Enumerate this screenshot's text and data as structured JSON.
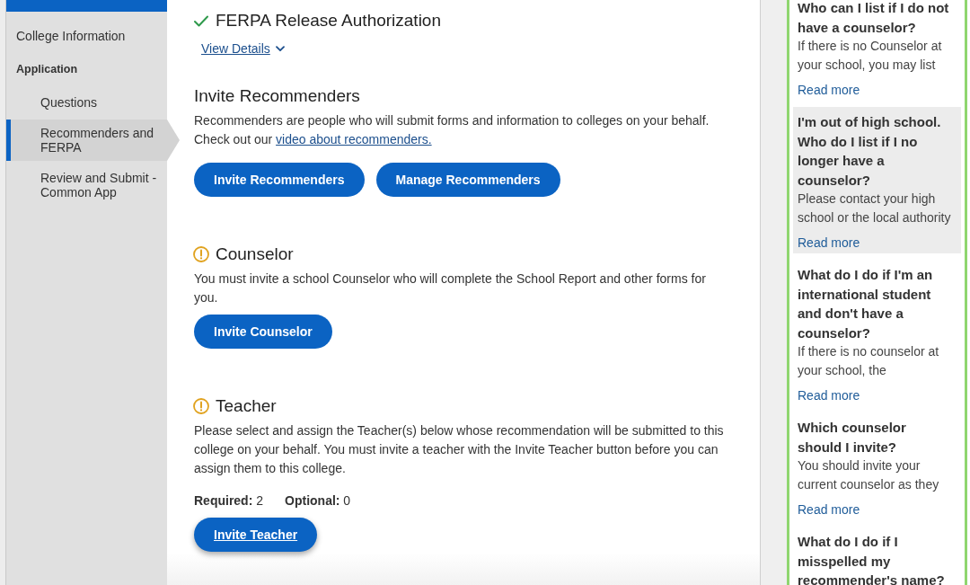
{
  "sidebar": {
    "items": [
      {
        "label": "College Information",
        "selected": false
      }
    ],
    "group": {
      "title": "Application",
      "items": [
        {
          "label": "Questions",
          "selected": false
        },
        {
          "label": "Recommenders and FERPA",
          "selected": true
        },
        {
          "label": "Review and Submit - Common App",
          "selected": false
        }
      ]
    }
  },
  "sections": [
    {
      "complete": true,
      "title": "FERPA Release Authorization",
      "link": "View Details"
    },
    {
      "title": "Invite Recommenders",
      "text": "Recommenders are people who will submit forms and information to colleges on your behalf. Check out our",
      "text_link": "video about recommenders.",
      "buttons": [
        {
          "label": "Invite Recommenders",
          "focused": false
        },
        {
          "label": "Manage Recommenders",
          "focused": false
        }
      ]
    },
    {
      "complete": false,
      "title": "Counselor",
      "text": "You must invite a school Counselor who will complete the School Report and other forms for you.",
      "buttons": [
        {
          "label": "Invite Counselor",
          "focused": false
        }
      ]
    },
    {
      "complete": false,
      "title": "Teacher",
      "text": "Please select and assign the Teacher(s) below whose recommendation will be submitted to this college on your behalf. You must invite a teacher with the Invite Teacher button before you can assign them to this college.",
      "counts": [
        "**Required:** 2",
        "**Optional:** 0"
      ],
      "buttons": [
        {
          "label": "Invite Teacher",
          "focused": true
        }
      ]
    }
  ],
  "faq": {
    "items": [
      {
        "question": "Who can I list if I do not have a counselor?",
        "answer": "If there is no Counselor at your school, you may list",
        "link": "Read more",
        "highlighted": false
      },
      {
        "question": "I'm out of high school. Who do I list if I no longer have a counselor?",
        "answer": "Please contact your high school or the local authority",
        "link": "Read more",
        "highlighted": true
      },
      {
        "question": "What do I do if I'm an international student and don't have a counselor?",
        "answer": "If there is no counselor at your school, the",
        "link": "Read more",
        "highlighted": false
      },
      {
        "question": "Which counselor should I invite?",
        "answer": "You should invite your current counselor as they",
        "link": "Read more",
        "highlighted": false
      },
      {
        "question": "What do I do if I misspelled my recommender's name?",
        "highlighted": false
      }
    ]
  }
}
